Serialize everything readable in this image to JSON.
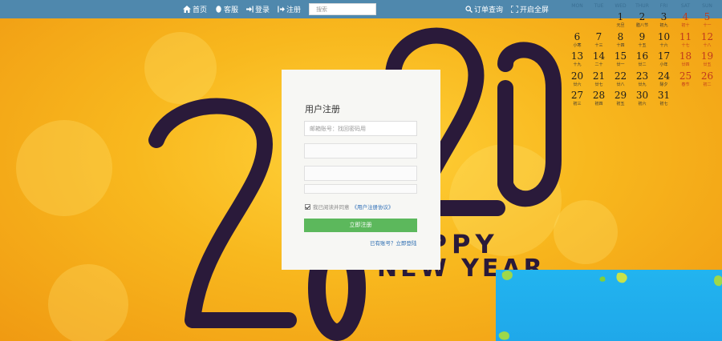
{
  "nav": {
    "home_label": "首页",
    "service_label": "客服",
    "login_label": "登录",
    "register_label": "注册",
    "search_placeholder": "搜索",
    "orders_label": "订单查询",
    "fullscreen_label": "开启全屏"
  },
  "background": {
    "year_text": "2020",
    "greeting_line1": "HAPPY",
    "greeting_line2": "NEW YEAR"
  },
  "calendar": {
    "weekdays": [
      "MON",
      "TUE",
      "WED",
      "THUR",
      "FRI",
      "SAT",
      "SUN"
    ],
    "rows": [
      [
        {
          "n": "",
          "l": ""
        },
        {
          "n": "",
          "l": ""
        },
        {
          "n": "1",
          "l": "元旦"
        },
        {
          "n": "2",
          "l": "腊八节"
        },
        {
          "n": "3",
          "l": "初九"
        },
        {
          "n": "4",
          "l": "初十"
        },
        {
          "n": "5",
          "l": "十一"
        }
      ],
      [
        {
          "n": "6",
          "l": "小寒"
        },
        {
          "n": "7",
          "l": "十三"
        },
        {
          "n": "8",
          "l": "十四"
        },
        {
          "n": "9",
          "l": "十五"
        },
        {
          "n": "10",
          "l": "十六"
        },
        {
          "n": "11",
          "l": "十七"
        },
        {
          "n": "12",
          "l": "十八"
        }
      ],
      [
        {
          "n": "13",
          "l": "十九"
        },
        {
          "n": "14",
          "l": "二十"
        },
        {
          "n": "15",
          "l": "廿一"
        },
        {
          "n": "16",
          "l": "廿二"
        },
        {
          "n": "17",
          "l": "小年"
        },
        {
          "n": "18",
          "l": "廿四"
        },
        {
          "n": "19",
          "l": "廿五"
        }
      ],
      [
        {
          "n": "20",
          "l": "廿六"
        },
        {
          "n": "21",
          "l": "廿七"
        },
        {
          "n": "22",
          "l": "廿八"
        },
        {
          "n": "23",
          "l": "廿九"
        },
        {
          "n": "24",
          "l": "除夕"
        },
        {
          "n": "25",
          "l": "春节"
        },
        {
          "n": "26",
          "l": "初二"
        }
      ],
      [
        {
          "n": "27",
          "l": "初三"
        },
        {
          "n": "28",
          "l": "初四"
        },
        {
          "n": "29",
          "l": "初五"
        },
        {
          "n": "30",
          "l": "初六"
        },
        {
          "n": "31",
          "l": "初七"
        },
        {
          "n": "",
          "l": ""
        },
        {
          "n": "",
          "l": ""
        }
      ]
    ]
  },
  "register": {
    "title": "用户注册",
    "email_placeholder": "邮箱账号：找回密码用",
    "agree_text": "我已阅读并同意",
    "agreement_link": "《用户注册协议》",
    "submit_label": "立即注册",
    "login_link": "已有账号？立即登陆"
  },
  "colors": {
    "topbar": "#4f88ad",
    "submit": "#5cb85c",
    "weekend": "#c0391d"
  }
}
